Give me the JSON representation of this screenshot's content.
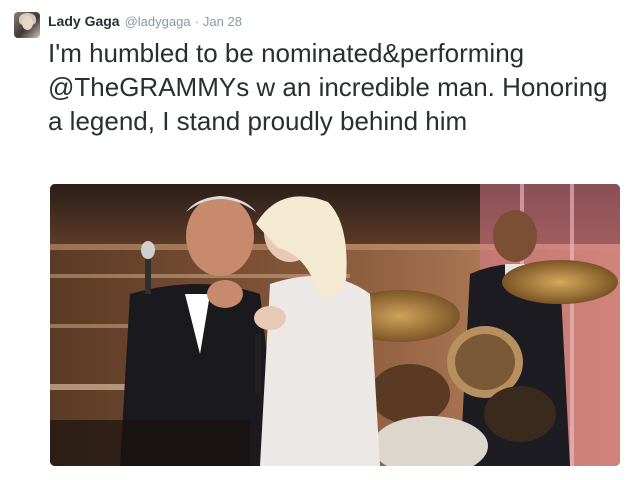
{
  "tweet": {
    "avatar_icon": "user-avatar",
    "display_name": "Lady Gaga",
    "handle": "@ladygaga",
    "separator": "·",
    "timestamp": "Jan 28",
    "text_part1": "I'm humbled to be nominated&performing ",
    "mention": "@TheGRAMMYs",
    "text_part2": " w an incredible man. Honoring a legend, I stand proudly behind him",
    "mention_color": "#292f33",
    "text_color": "#292f33",
    "meta_color": "#8899a6",
    "media": {
      "type": "photo",
      "description_icon": "photo-stage-performance"
    }
  }
}
